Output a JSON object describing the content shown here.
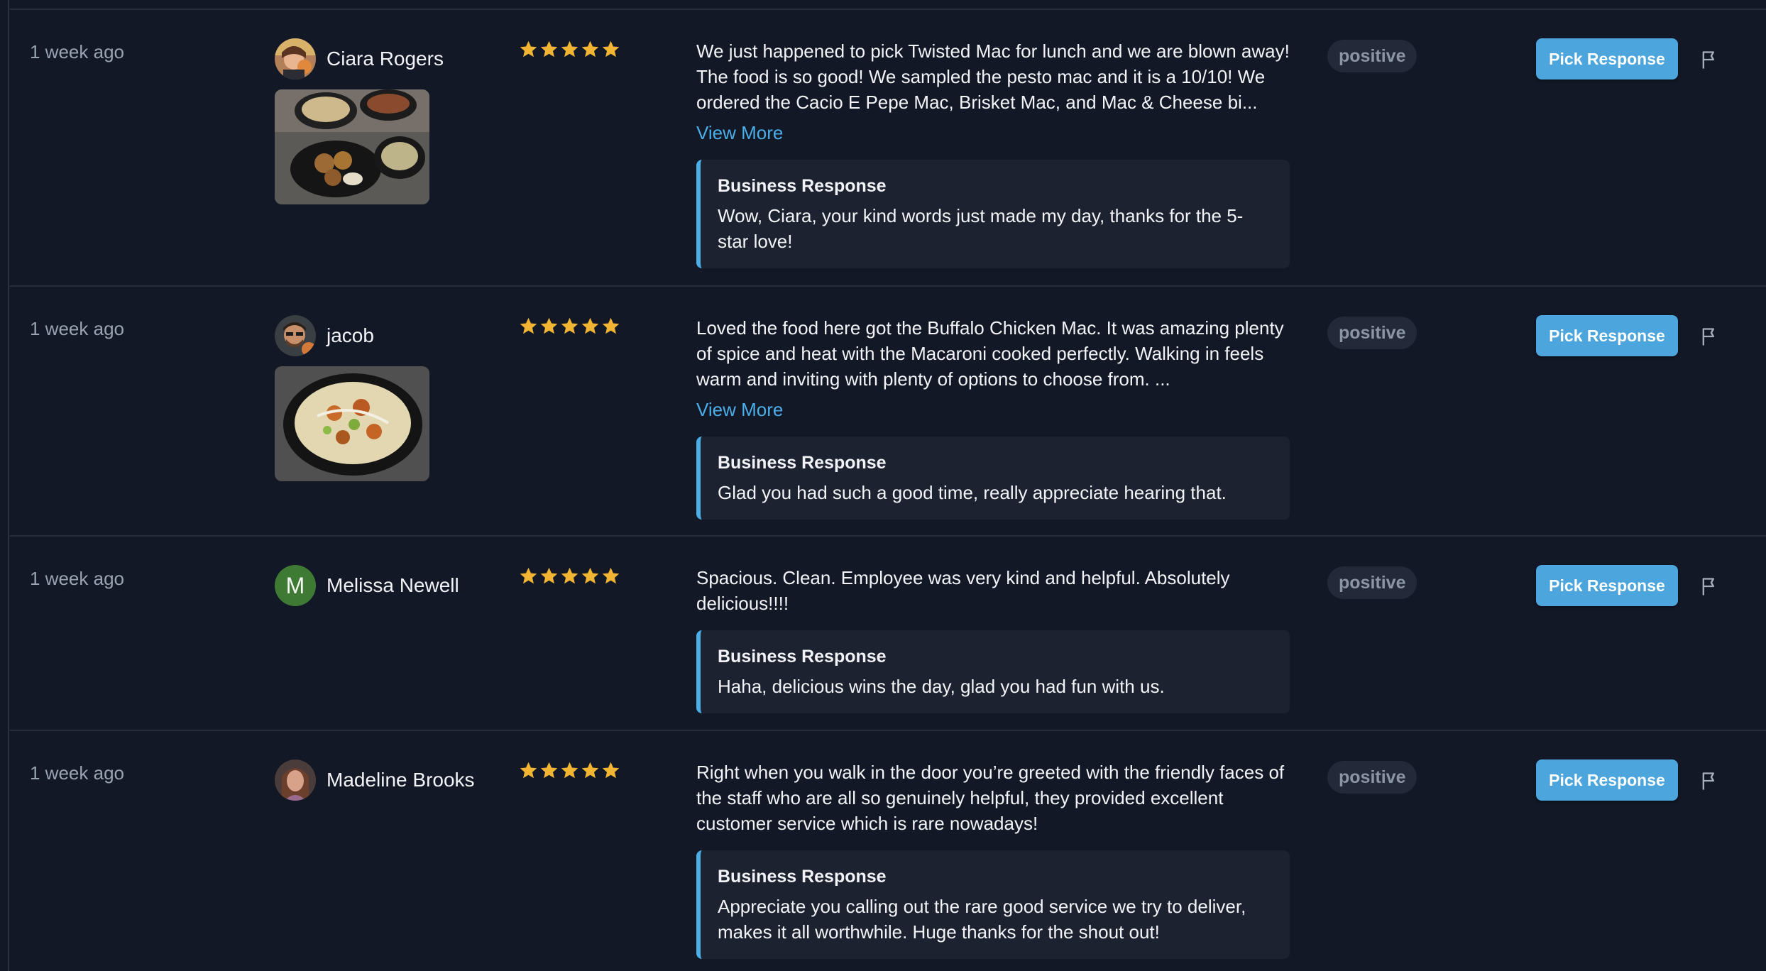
{
  "labels": {
    "view_more": "View More",
    "business_response": "Business Response",
    "pick_response": "Pick Response"
  },
  "colors": {
    "accent": "#4ca5dc",
    "star": "#f2b533",
    "background": "#121826"
  },
  "reviews": [
    {
      "date": "1 week ago",
      "name": "Ciara Rogers",
      "rating": 5,
      "text": "We just happened to pick Twisted Mac for lunch and we are blown away! The food is so good! We sampled the pesto mac and it is a 10/10! We ordered the Cacio E Pepe Mac, Brisket Mac, and Mac & Cheese bi...",
      "response": "Wow, Ciara, your kind words just made my day, thanks for the 5-star love!",
      "sentiment": "positive"
    },
    {
      "date": "1 week ago",
      "name": "jacob",
      "rating": 5,
      "text": "Loved the food here got the Buffalo Chicken Mac. It was amazing plenty of spice and heat with the Macaroni cooked perfectly. Walking in feels warm and inviting with plenty of options to choose from. ...",
      "response": "Glad you had such a good time, really appreciate hearing that.",
      "sentiment": "positive"
    },
    {
      "date": "1 week ago",
      "name": "Melissa Newell",
      "avatar_letter": "M",
      "rating": 5,
      "text": "Spacious. Clean. Employee was very kind and helpful. Absolutely delicious!!!!",
      "response": "Haha, delicious wins the day, glad you had fun with us.",
      "sentiment": "positive"
    },
    {
      "date": "1 week ago",
      "name": "Madeline Brooks",
      "rating": 5,
      "text": "Right when you walk in the door you’re greeted with the friendly faces of the staff who are all so genuinely helpful, they provided excellent customer service which is rare nowadays!",
      "response": "Appreciate you calling out the rare good service we try to deliver, makes it all worthwhile. Huge thanks for the shout out!",
      "sentiment": "positive"
    }
  ]
}
